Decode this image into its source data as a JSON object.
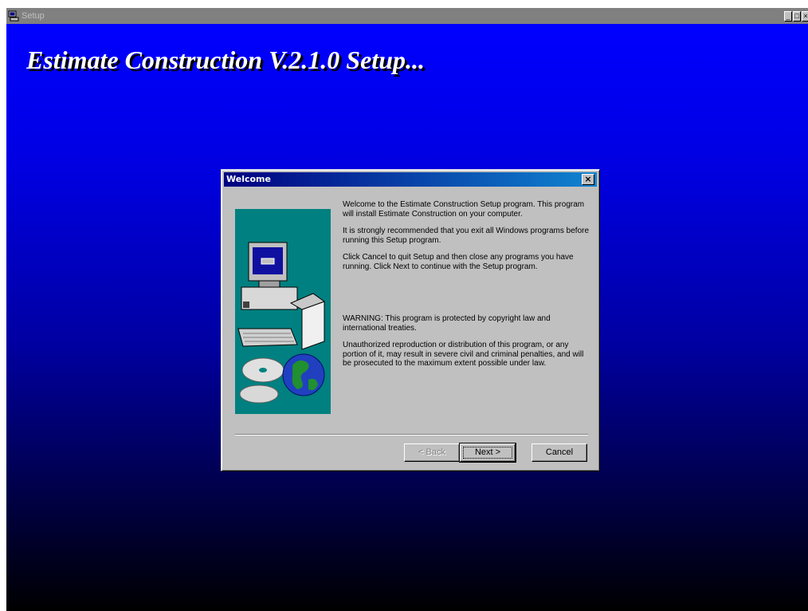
{
  "window": {
    "title": "Setup",
    "minimize_glyph": "_",
    "maximize_glyph": "□",
    "close_glyph": "×"
  },
  "heading": "Estimate Construction V.2.1.0  Setup...",
  "dialog": {
    "title": "Welcome",
    "close_glyph": "×",
    "paragraphs": [
      "Welcome to the Estimate Construction Setup program.  This program will install Estimate Construction on your computer.",
      "It is strongly recommended that you exit all Windows programs before running this Setup program.",
      "Click Cancel to quit Setup and then close any programs you have running.  Click Next to continue with the Setup program.",
      "WARNING: This program is protected by copyright law and international treaties.",
      "Unauthorized reproduction or distribution of this program, or any portion of it, may result in severe civil and criminal penalties, and will be prosecuted to the maximum extent possible under law."
    ],
    "buttons": {
      "back": "< Back",
      "next": "Next >",
      "cancel": "Cancel"
    }
  },
  "colors": {
    "desktop_top": "#0000ff",
    "desktop_bottom": "#000000",
    "dialog_face": "#c0c0c0",
    "titlebar_active": "#000080",
    "illustration_bg": "#008080"
  }
}
